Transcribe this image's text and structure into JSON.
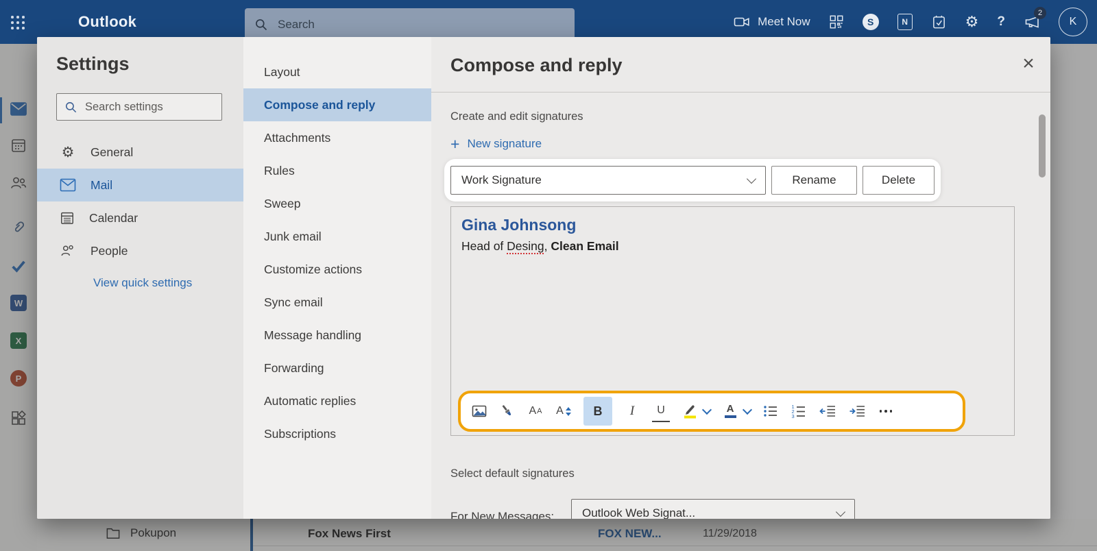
{
  "topbar": {
    "brand": "Outlook",
    "search_placeholder": "Search",
    "meet_now_label": "Meet Now",
    "skype_letter": "S",
    "onenote_letter": "N",
    "notification_badge": "2",
    "avatar_initial": "K"
  },
  "rail": {
    "word_letter": "W",
    "excel_letter": "X",
    "powerpoint_letter": "P"
  },
  "settings_panel": {
    "title": "Settings",
    "search_placeholder": "Search settings",
    "items": [
      {
        "label": "General",
        "selected": false
      },
      {
        "label": "Mail",
        "selected": true
      },
      {
        "label": "Calendar",
        "selected": false
      },
      {
        "label": "People",
        "selected": false
      }
    ],
    "quick_settings_link": "View quick settings"
  },
  "settings_nav": {
    "items": [
      {
        "label": "Layout",
        "selected": false
      },
      {
        "label": "Compose and reply",
        "selected": true
      },
      {
        "label": "Attachments",
        "selected": false
      },
      {
        "label": "Rules",
        "selected": false
      },
      {
        "label": "Sweep",
        "selected": false
      },
      {
        "label": "Junk email",
        "selected": false
      },
      {
        "label": "Customize actions",
        "selected": false
      },
      {
        "label": "Sync email",
        "selected": false
      },
      {
        "label": "Message handling",
        "selected": false
      },
      {
        "label": "Forwarding",
        "selected": false
      },
      {
        "label": "Automatic replies",
        "selected": false
      },
      {
        "label": "Subscriptions",
        "selected": false
      }
    ]
  },
  "panel": {
    "title": "Compose and reply",
    "signatures_section_label": "Create and edit signatures",
    "new_signature_label": "New signature",
    "signature_select_value": "Work Signature",
    "rename_button": "Rename",
    "delete_button": "Delete",
    "signature_editor": {
      "name": "Gina Johnsong",
      "title_prefix": "Head of ",
      "title_misspelled_word": "Desing",
      "title_separator": ", ",
      "company_bold": "Clean Email"
    },
    "toolbar_icons": [
      "insert-image",
      "format-painter",
      "font-name",
      "font-size",
      "bold",
      "italic",
      "underline",
      "text-highlight",
      "text-highlight-dropdown",
      "font-color",
      "font-color-dropdown",
      "bulleted-list",
      "numbered-list",
      "decrease-indent",
      "increase-indent",
      "more-formatting"
    ],
    "toolbar_active": "bold",
    "defaults_section_label": "Select default signatures",
    "default_row_label": "For New Messages:",
    "default_row_value": "Outlook Web Signat..."
  },
  "background_page": {
    "folder_label": "Pokupon",
    "message_subject": "Fox News First",
    "message_sender": "FOX NEW...",
    "message_date": "11/29/2018"
  },
  "colors": {
    "topbar": "#19477e",
    "selection_highlight": "#bcd0e5",
    "selected_text": "#1b5599",
    "link": "#2e6bb0",
    "signature_name": "#2b579a",
    "spotlight_ring": "#f0a30a",
    "bold_active_bg": "#c5dbf2"
  }
}
